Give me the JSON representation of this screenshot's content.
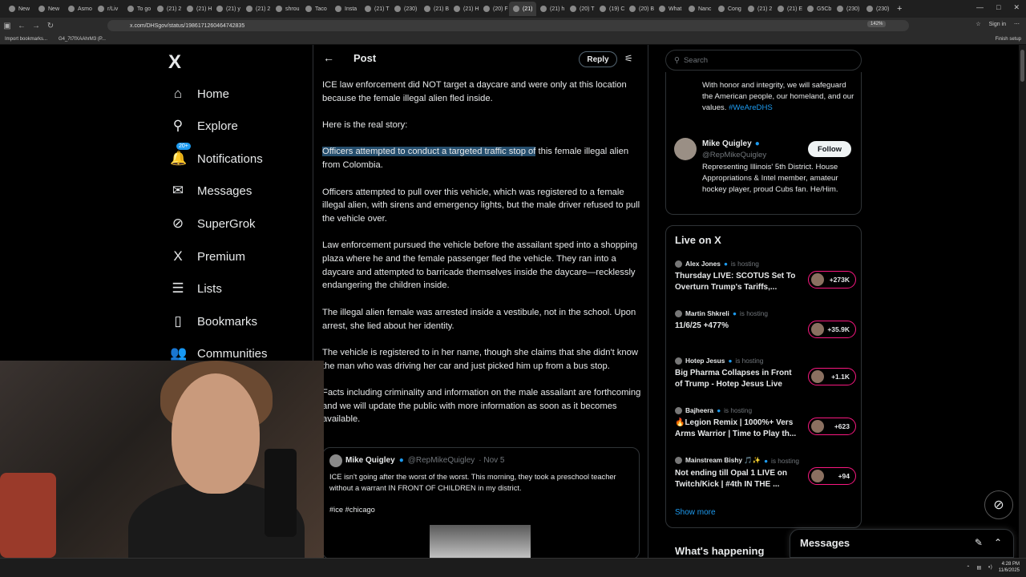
{
  "browser": {
    "tabs": [
      {
        "label": "New"
      },
      {
        "label": "New"
      },
      {
        "label": "Asmo"
      },
      {
        "label": "r/Liv"
      },
      {
        "label": "To go"
      },
      {
        "label": "(21) 2"
      },
      {
        "label": "(21) H"
      },
      {
        "label": "(21) y"
      },
      {
        "label": "(21) 2"
      },
      {
        "label": "shrou"
      },
      {
        "label": "Taco"
      },
      {
        "label": "Insta"
      },
      {
        "label": "(21) T"
      },
      {
        "label": "(230)"
      },
      {
        "label": "(21) B"
      },
      {
        "label": "(21) H"
      },
      {
        "label": "(20) F"
      },
      {
        "label": "(21)",
        "active": true
      },
      {
        "label": "(21) h"
      },
      {
        "label": "(20) T"
      },
      {
        "label": "(19) C"
      },
      {
        "label": "(20) B"
      },
      {
        "label": "What"
      },
      {
        "label": "Nanc"
      },
      {
        "label": "Cong"
      },
      {
        "label": "(21) 2"
      },
      {
        "label": "(21) E"
      },
      {
        "label": "G5Cb"
      },
      {
        "label": "(230)"
      },
      {
        "label": "(230)"
      }
    ],
    "url": "x.com/DHSgov/status/1986171260464742835",
    "zoom": "142%",
    "sign_in": "Sign in",
    "bookmarks": [
      "Import bookmarks...",
      "G4_7t7fXAAhrM3 (P..."
    ],
    "finish_setup": "Finish setup"
  },
  "leftnav": {
    "logo": "X",
    "items": [
      {
        "label": "Home",
        "icon": "home-icon",
        "glyph": "⌂"
      },
      {
        "label": "Explore",
        "icon": "search-icon",
        "glyph": "⚲"
      },
      {
        "label": "Notifications",
        "icon": "bell-icon",
        "glyph": "🔔",
        "badge": "20+"
      },
      {
        "label": "Messages",
        "icon": "mail-icon",
        "glyph": "✉"
      },
      {
        "label": "SuperGrok",
        "icon": "grok-icon",
        "glyph": "⊘"
      },
      {
        "label": "Premium",
        "icon": "x-premium-icon",
        "glyph": "X"
      },
      {
        "label": "Lists",
        "icon": "list-icon",
        "glyph": "☰"
      },
      {
        "label": "Bookmarks",
        "icon": "bookmark-icon",
        "glyph": "▯"
      },
      {
        "label": "Communities",
        "icon": "communities-icon",
        "glyph": "👥"
      }
    ]
  },
  "main": {
    "title": "Post",
    "reply_label": "Reply",
    "paragraphs": [
      {
        "text": "ICE law enforcement did NOT target a daycare and were only at this location because the female illegal alien fled inside."
      },
      {
        "text": "Here is the real story:"
      },
      {
        "highlight": "Officers attempted to conduct a targeted traffic stop of",
        "text": " this female illegal alien from Colombia."
      },
      {
        "text": "Officers attempted to pull over this vehicle, which was registered to a female illegal alien, with sirens and emergency lights, but the male driver refused to pull the vehicle over."
      },
      {
        "text": "Law enforcement pursued the vehicle before the assailant sped into a shopping plaza where he and the female passenger fled the vehicle. They ran into a daycare and attempted to barricade themselves inside the daycare—recklessly endangering the children inside."
      },
      {
        "text": "The illegal alien female was arrested inside a vestibule, not in the school. Upon arrest, she lied about her identity."
      },
      {
        "text": "The vehicle is registered to in her name, though she claims that she didn't know the man who was driving her car and just picked him up from a bus stop."
      },
      {
        "text": "Facts including criminality and information on the male assailant are forthcoming and we will update the public with more information as soon as it becomes available."
      }
    ],
    "quote": {
      "name": "Mike Quigley",
      "handle": "@RepMikeQuigley",
      "date": "· Nov 5",
      "text": "ICE isn't going after the worst of the worst. This morning, they took a preschool teacher without a warrant IN FRONT OF CHILDREN in my district.",
      "tags": "#ice #chicago"
    }
  },
  "right": {
    "search_placeholder": "Search",
    "dhs": {
      "text": "With honor and integrity, we will safeguard the American people, our homeland, and our values.",
      "hashtag": "#WeAreDHS"
    },
    "suggest": {
      "name": "Mike Quigley",
      "handle": "@RepMikeQuigley",
      "bio": "Representing Illinois' 5th District. House Appropriations & Intel member, amateur hockey player, proud Cubs fan. He/Him.",
      "follow_label": "Follow"
    },
    "live": {
      "title": "Live on X",
      "status": "is hosting",
      "items": [
        {
          "host": "Alex Jones",
          "title": "Thursday LIVE: SCOTUS Set To Overturn Trump's Tariffs,...",
          "count": "+273K"
        },
        {
          "host": "Martin Shkreli",
          "title": "11/6/25 +477%",
          "count": "+35.9K"
        },
        {
          "host": "Hotep Jesus",
          "title": "Big Pharma Collapses in Front of Trump - Hotep Jesus Live",
          "count": "+1.1K"
        },
        {
          "host": "Bajheera",
          "title": "🔥Legion Remix | 1000%+ Vers Arms Warrior | Time to Play th...",
          "count": "+623"
        },
        {
          "host": "Mainstream Bishy 🎵✨",
          "title": "Not ending till Opal 1 LIVE on Twitch/Kick | #4th IN THE ...",
          "count": "+94"
        }
      ],
      "show_more": "Show more"
    },
    "whats_happening": "What's happening"
  },
  "messages_panel": {
    "title": "Messages"
  },
  "taskbar": {
    "time": "4:28 PM",
    "date": "11/6/2025"
  },
  "colors": {
    "accent": "#1d9bf0",
    "live": "#f91880",
    "highlight": "#264f6e"
  }
}
